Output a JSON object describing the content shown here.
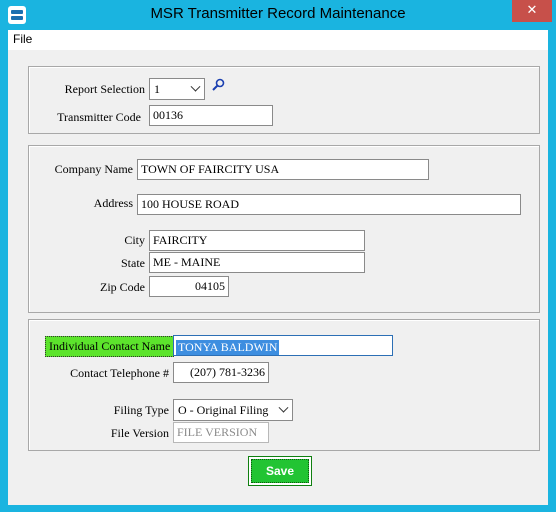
{
  "window": {
    "title": "MSR Transmitter Record Maintenance",
    "close_glyph": "✕"
  },
  "menu": {
    "file": "File"
  },
  "report": {
    "selection_label": "Report Selection",
    "selection_value": "1",
    "transmitter_code_label": "Transmitter Code",
    "transmitter_code_value": "00136"
  },
  "company": {
    "name_label": "Company Name",
    "name_value": "TOWN OF FAIRCITY USA",
    "address_label": "Address",
    "address_value": "100 HOUSE ROAD",
    "city_label": "City",
    "city_value": "FAIRCITY",
    "state_label": "State",
    "state_value": "ME - MAINE",
    "zip_label": "Zip Code",
    "zip_value": "04105"
  },
  "contact": {
    "name_label": "Individual Contact Name",
    "name_value": "TONYA BALDWIN",
    "phone_label": "Contact Telephone #",
    "phone_value": "(207) 781-3236",
    "filing_type_label": "Filing Type",
    "filing_type_value": "O - Original Filing",
    "file_version_label": "File Version",
    "file_version_placeholder": "FILE VERSION"
  },
  "actions": {
    "save_label": "Save"
  },
  "colors": {
    "titlebar": "#1ab4e0",
    "close": "#c7504a",
    "contact_label_bg": "#5ce42c",
    "selection_bg": "#3d8ee0",
    "save_bg": "#22c433"
  }
}
